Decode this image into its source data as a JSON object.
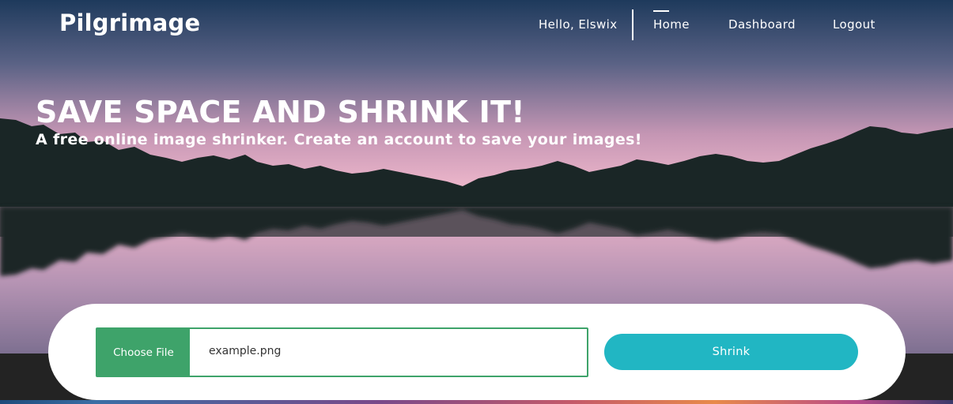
{
  "brand": {
    "name": "Pilgrimage"
  },
  "nav": {
    "greeting": "Hello, Elswix",
    "links": [
      {
        "label": "Home",
        "active": true
      },
      {
        "label": "Dashboard",
        "active": false
      },
      {
        "label": "Logout",
        "active": false
      }
    ]
  },
  "hero": {
    "headline": "SAVE SPACE AND SHRINK IT!",
    "subheadline": "A free online image shrinker. Create an account to save your images!"
  },
  "upload": {
    "choose_label": "Choose File",
    "file_name": "example.png",
    "submit_label": "Shrink"
  },
  "colors": {
    "accent_green": "#3ea36a",
    "accent_teal": "#21b6c3",
    "sky_top": "#1f3b5c",
    "sky_pink": "#e8b2c8",
    "mountain": "#1a2626"
  }
}
